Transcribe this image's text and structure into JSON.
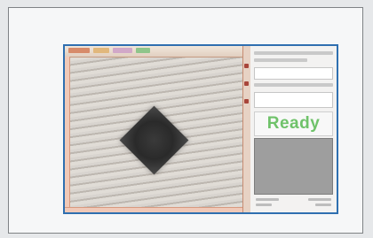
{
  "status": {
    "label": "Ready",
    "color": "#6fc26a"
  },
  "colors": {
    "frame_border": "#2f6fb0",
    "accent_toolbar": "#c49a82"
  },
  "icons": [
    "diamond-shape-icon"
  ]
}
